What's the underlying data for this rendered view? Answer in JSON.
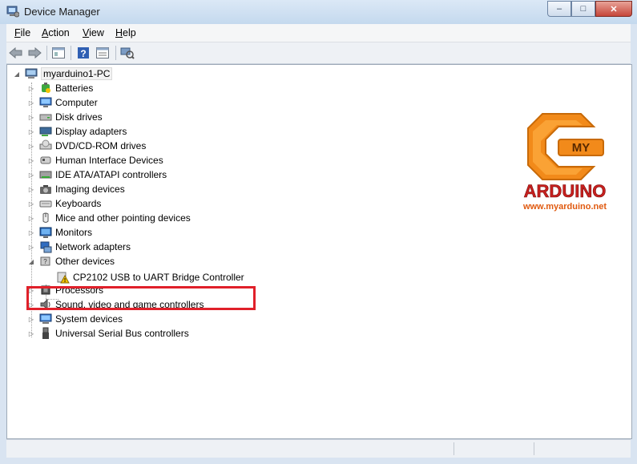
{
  "window": {
    "title": "Device Manager",
    "minimize": "‒",
    "maximize": "□",
    "close": "✕"
  },
  "menu": [
    {
      "key": "F",
      "rest": "ile"
    },
    {
      "key": "A",
      "rest": "ction"
    },
    {
      "key": "V",
      "rest": "iew"
    },
    {
      "key": "H",
      "rest": "elp"
    }
  ],
  "toolbar": [
    "back-icon",
    "forward-icon",
    "properties-panel-icon",
    "help-icon",
    "view-panel-icon",
    "scan-hardware-icon"
  ],
  "tree": {
    "root": "myarduino1-PC",
    "categories": [
      {
        "label": "Batteries",
        "icon": "battery-icon"
      },
      {
        "label": "Computer",
        "icon": "computer-icon"
      },
      {
        "label": "Disk drives",
        "icon": "disk-drive-icon"
      },
      {
        "label": "Display adapters",
        "icon": "display-adapter-icon"
      },
      {
        "label": "DVD/CD-ROM drives",
        "icon": "dvd-drive-icon"
      },
      {
        "label": "Human Interface Devices",
        "icon": "hid-icon"
      },
      {
        "label": "IDE ATA/ATAPI controllers",
        "icon": "ide-controller-icon"
      },
      {
        "label": "Imaging devices",
        "icon": "camera-icon"
      },
      {
        "label": "Keyboards",
        "icon": "keyboard-icon"
      },
      {
        "label": "Mice and other pointing devices",
        "icon": "mouse-icon"
      },
      {
        "label": "Monitors",
        "icon": "monitor-icon"
      },
      {
        "label": "Network adapters",
        "icon": "network-adapter-icon"
      },
      {
        "label": "Other devices",
        "icon": "other-devices-icon",
        "expanded": true,
        "children": [
          {
            "label": "CP2102 USB to UART Bridge Controller",
            "icon": "unknown-device-warning-icon"
          }
        ]
      },
      {
        "label": "Processors",
        "icon": "processor-icon"
      },
      {
        "label": "Sound, video and game controllers",
        "icon": "speaker-icon"
      },
      {
        "label": "System devices",
        "icon": "system-devices-icon"
      },
      {
        "label": "Universal Serial Bus controllers",
        "icon": "usb-icon"
      }
    ]
  },
  "logo": {
    "badge": "MY",
    "name": "ARDUINO",
    "url": "www.myarduino.net"
  },
  "colors": {
    "highlight": "#e0202a",
    "logo_orange": "#f28a1a",
    "logo_red": "#c8201e"
  }
}
